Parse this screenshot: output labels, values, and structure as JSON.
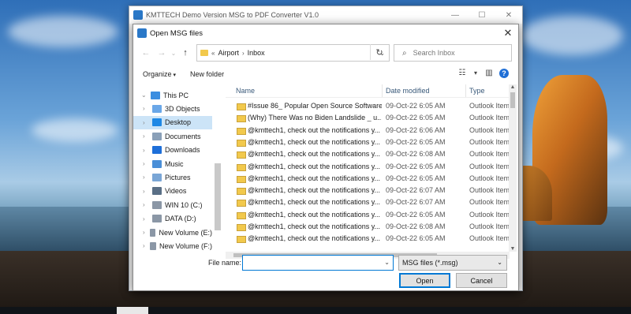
{
  "app": {
    "title": "KMTTECH Demo Version MSG to PDF Converter V1.0",
    "controls": {
      "minimize": "—",
      "maximize": "☐",
      "close": "✕"
    }
  },
  "dialog": {
    "title": "Open MSG files",
    "close": "✕",
    "nav": {
      "back": "←",
      "forward": "→",
      "history": "⌄",
      "up": "↑"
    },
    "address": {
      "prefix": "«",
      "crumbs": [
        "Airport",
        "Inbox"
      ],
      "separator": "›",
      "dropdown": "⌄",
      "refresh": "↻"
    },
    "search": {
      "placeholder": "Search Inbox",
      "icon": "⌕"
    },
    "toolbar": {
      "organize": "Organize",
      "new_folder": "New folder",
      "view_icon": "☷",
      "view_caret": "▾",
      "preview_icon": "▥",
      "help": "?"
    },
    "nav_pane": {
      "items": [
        {
          "label": "This PC",
          "icon": "pc-icon",
          "color": "#3b8ee0"
        },
        {
          "label": "3D Objects",
          "icon": "cube-icon",
          "color": "#6aa7e8"
        },
        {
          "label": "Desktop",
          "icon": "desktop-icon",
          "color": "#1e88e5",
          "selected": true
        },
        {
          "label": "Documents",
          "icon": "document-icon",
          "color": "#8aa0b8"
        },
        {
          "label": "Downloads",
          "icon": "download-icon",
          "color": "#1e6fd9"
        },
        {
          "label": "Music",
          "icon": "music-icon",
          "color": "#4a8fd8"
        },
        {
          "label": "Pictures",
          "icon": "pictures-icon",
          "color": "#7aa6d6"
        },
        {
          "label": "Videos",
          "icon": "video-icon",
          "color": "#5a6f86"
        },
        {
          "label": "WIN 10 (C:)",
          "icon": "drive-icon",
          "color": "#8b97a6"
        },
        {
          "label": "DATA (D:)",
          "icon": "drive-icon",
          "color": "#8b97a6"
        },
        {
          "label": "New Volume (E:)",
          "icon": "drive-icon",
          "color": "#8b97a6"
        },
        {
          "label": "New Volume (F:)",
          "icon": "drive-icon",
          "color": "#8b97a6"
        }
      ]
    },
    "columns": {
      "name": "Name",
      "date": "Date modified",
      "type": "Type",
      "sort_indicator": "^"
    },
    "files": [
      {
        "name": "#Issue 86_ Popular Open Source Software...",
        "date": "09-Oct-22 6:05 AM",
        "type": "Outlook Item"
      },
      {
        "name": "(Why) There Was no Biden Landslide _ u...",
        "date": "09-Oct-22 6:05 AM",
        "type": "Outlook Item"
      },
      {
        "name": "@kmttech1, check out the notifications y...",
        "date": "09-Oct-22 6:06 AM",
        "type": "Outlook Item"
      },
      {
        "name": "@kmttech1, check out the notifications y...",
        "date": "09-Oct-22 6:05 AM",
        "type": "Outlook Item"
      },
      {
        "name": "@kmttech1, check out the notifications y...",
        "date": "09-Oct-22 6:08 AM",
        "type": "Outlook Item"
      },
      {
        "name": "@kmttech1, check out the notifications y...",
        "date": "09-Oct-22 6:05 AM",
        "type": "Outlook Item"
      },
      {
        "name": "@kmttech1, check out the notifications y...",
        "date": "09-Oct-22 6:05 AM",
        "type": "Outlook Item"
      },
      {
        "name": "@kmttech1, check out the notifications y...",
        "date": "09-Oct-22 6:07 AM",
        "type": "Outlook Item"
      },
      {
        "name": "@kmttech1, check out the notifications y...",
        "date": "09-Oct-22 6:07 AM",
        "type": "Outlook Item"
      },
      {
        "name": "@kmttech1, check out the notifications y...",
        "date": "09-Oct-22 6:05 AM",
        "type": "Outlook Item"
      },
      {
        "name": "@kmttech1, check out the notifications y...",
        "date": "09-Oct-22 6:08 AM",
        "type": "Outlook Item"
      },
      {
        "name": "@kmttech1, check out the notifications y...",
        "date": "09-Oct-22 6:05 AM",
        "type": "Outlook Item"
      }
    ],
    "filename": {
      "label": "File name:",
      "value": "",
      "dropdown": "⌄"
    },
    "filetype": {
      "value": "MSG files (*.msg)",
      "dropdown": "⌄"
    },
    "buttons": {
      "open": "Open",
      "cancel": "Cancel"
    }
  }
}
